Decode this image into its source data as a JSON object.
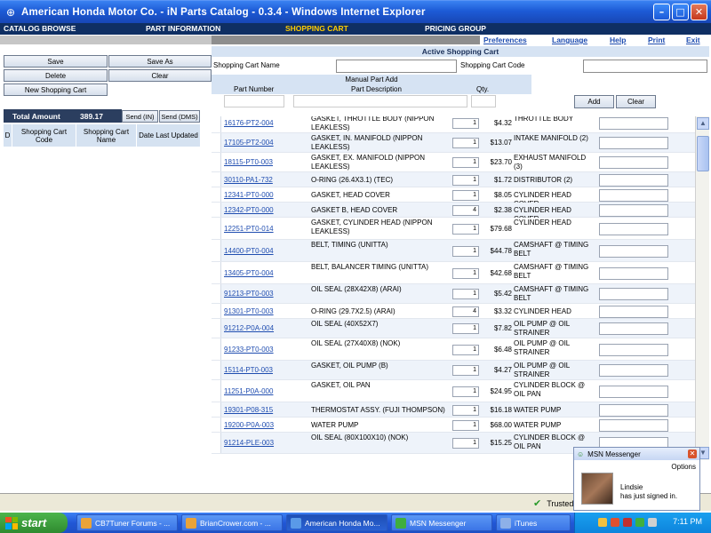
{
  "window": {
    "title": "American Honda Motor Co. - iN Parts Catalog - 0.3.4 - Windows Internet Explorer"
  },
  "nav": {
    "tabs": [
      {
        "label": "CATALOG BROWSE"
      },
      {
        "label": "PART INFORMATION"
      },
      {
        "label": "SHOPPING CART"
      },
      {
        "label": "PRICING GROUP"
      }
    ]
  },
  "links": {
    "preferences": "Preferences",
    "language": "Language",
    "help": "Help",
    "print": "Print",
    "exit": "Exit"
  },
  "left": {
    "save": "Save",
    "save_as": "Save As",
    "delete": "Delete",
    "clear": "Clear",
    "new_cart": "New Shopping Cart",
    "total_label": "Total Amount",
    "total_value": "389.17",
    "send_in": "Send (IN)",
    "send_dms": "Send (DMS)",
    "table_headers": [
      "D",
      "Shopping Cart Code",
      "Shopping Cart Name",
      "Date Last Updated"
    ]
  },
  "cart": {
    "title": "Active Shopping Cart",
    "name_label": "Shopping Cart Name",
    "code_label": "Shopping Cart Code",
    "manual_title": "Manual Part Add",
    "manual_headers": [
      "Part Number",
      "Part Description",
      "Qty."
    ],
    "add": "Add",
    "clear": "Clear"
  },
  "grid": {
    "rows": [
      {
        "pn": "16176-PT2-004",
        "desc": "GASKET, THROTTLE BODY (NIPPON LEAKLESS)",
        "qty": "1",
        "price": "$4.32",
        "cat": "THROTTLE BODY"
      },
      {
        "pn": "17105-PT2-004",
        "desc": "GASKET, IN. MANIFOLD (NIPPON LEAKLESS)",
        "qty": "1",
        "price": "$13.07",
        "cat": "INTAKE MANIFOLD (2)"
      },
      {
        "pn": "18115-PT0-003",
        "desc": "GASKET, EX. MANIFOLD (NIPPON LEAKLESS)",
        "qty": "1",
        "price": "$23.70",
        "cat": "EXHAUST MANIFOLD (3)"
      },
      {
        "pn": "30110-PA1-732",
        "desc": "O-RING (26.4X3.1) (TEC)",
        "qty": "1",
        "price": "$1.72",
        "cat": "DISTRIBUTOR (2)"
      },
      {
        "pn": "12341-PT0-000",
        "desc": "GASKET, HEAD COVER",
        "qty": "1",
        "price": "$8.05",
        "cat": "CYLINDER HEAD COVER"
      },
      {
        "pn": "12342-PT0-000",
        "desc": "GASKET B, HEAD COVER",
        "qty": "4",
        "price": "$2.38",
        "cat": "CYLINDER HEAD COVER"
      },
      {
        "pn": "12251-PT0-014",
        "desc": "GASKET, CYLINDER HEAD (NIPPON LEAKLESS)",
        "qty": "1",
        "price": "$79.68",
        "cat": "CYLINDER HEAD"
      },
      {
        "pn": "14400-PT0-004",
        "desc": "BELT, TIMING (UNITTA)",
        "qty": "1",
        "price": "$44.78",
        "cat": "CAMSHAFT @ TIMING BELT"
      },
      {
        "pn": "13405-PT0-004",
        "desc": "BELT, BALANCER TIMING (UNITTA)",
        "qty": "1",
        "price": "$42.68",
        "cat": "CAMSHAFT @ TIMING BELT"
      },
      {
        "pn": "91213-PT0-003",
        "desc": "OIL SEAL (28X42X8) (ARAI)",
        "qty": "1",
        "price": "$5.42",
        "cat": "CAMSHAFT @ TIMING BELT"
      },
      {
        "pn": "91301-PT0-003",
        "desc": "O-RING (29.7X2.5) (ARAI)",
        "qty": "4",
        "price": "$3.32",
        "cat": "CYLINDER HEAD"
      },
      {
        "pn": "91212-P0A-004",
        "desc": "OIL SEAL (40X52X7)",
        "qty": "1",
        "price": "$7.82",
        "cat": "OIL PUMP @ OIL STRAINER"
      },
      {
        "pn": "91233-PT0-003",
        "desc": "OIL SEAL (27X40X8) (NOK)",
        "qty": "1",
        "price": "$6.48",
        "cat": "OIL PUMP @ OIL STRAINER"
      },
      {
        "pn": "15114-PT0-003",
        "desc": "GASKET, OIL PUMP (B)",
        "qty": "1",
        "price": "$4.27",
        "cat": "OIL PUMP @ OIL STRAINER"
      },
      {
        "pn": "11251-P0A-000",
        "desc": "GASKET, OIL PAN",
        "qty": "1",
        "price": "$24.95",
        "cat": "CYLINDER BLOCK @ OIL PAN"
      },
      {
        "pn": "19301-P08-315",
        "desc": "THERMOSTAT ASSY. (FUJI THOMPSON)",
        "qty": "1",
        "price": "$16.18",
        "cat": "WATER PUMP"
      },
      {
        "pn": "19200-P0A-003",
        "desc": "WATER PUMP",
        "qty": "1",
        "price": "$68.00",
        "cat": "WATER PUMP"
      },
      {
        "pn": "91214-PLE-003",
        "desc": "OIL SEAL (80X100X10) (NOK)",
        "qty": "1",
        "price": "$15.25",
        "cat": "CYLINDER BLOCK @ OIL PAN"
      }
    ]
  },
  "status": {
    "zone": "Trusted"
  },
  "msn": {
    "title": "MSN Messenger",
    "options": "Options",
    "name": "Lindsie",
    "message": "has just signed in."
  },
  "taskbar": {
    "start": "start",
    "tasks": [
      {
        "label": "CB7Tuner Forums - ..."
      },
      {
        "label": "BrianCrower.com - ..."
      },
      {
        "label": "American Honda Mo..."
      },
      {
        "label": "MSN Messenger"
      },
      {
        "label": "iTunes"
      }
    ],
    "clock": "7:11 PM"
  },
  "colors": {
    "titlebar": "#1d5bd6",
    "navbar": "#0f2f63",
    "active_tab": "#ffcc00",
    "link": "#1f4db0",
    "header_fill": "#d6e3f3",
    "taskbar": "#2157d6",
    "start_button": "#3a9a3a"
  }
}
